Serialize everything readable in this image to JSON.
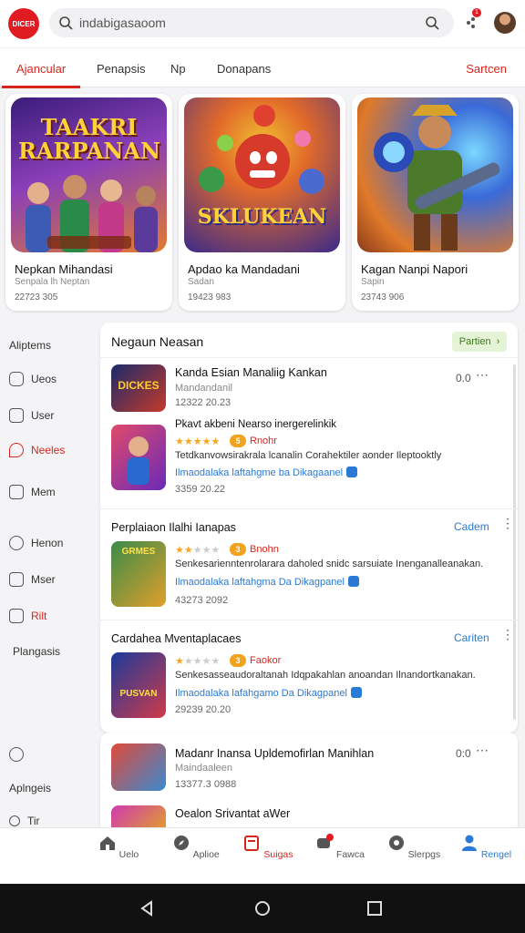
{
  "top": {
    "logo_text": "DICER",
    "search_text": "indabigasaoom",
    "notif_count": "1"
  },
  "tabs": {
    "items": [
      "Ajancular",
      "Penapsis",
      "Np",
      "Donapans"
    ],
    "right": "Sartcen"
  },
  "cards": [
    {
      "art_text": "TAAKRI RARPANAN",
      "title": "Nepkan Mihandasi",
      "sub": "Senpala lh Neptan",
      "num": "22723 305"
    },
    {
      "art_text": "SKLUKEAN",
      "title": "Apdao ka Mandadani",
      "sub": "Sadan",
      "num": "19423 983"
    },
    {
      "art_text": "",
      "title": "Kagan Nanpi Napori",
      "sub": "Sapin",
      "num": "23743 906"
    }
  ],
  "sidebar": [
    {
      "label": "Aliptems",
      "icon": "none"
    },
    {
      "label": "Ueos",
      "icon": "circle-icon"
    },
    {
      "label": "User",
      "icon": "square-icon"
    },
    {
      "label": "Neeles",
      "icon": "pin-icon"
    },
    {
      "label": "Mem",
      "icon": "image-icon"
    },
    {
      "label": "Henon",
      "icon": "circle-icon"
    },
    {
      "label": "Mser",
      "icon": "list-icon"
    },
    {
      "label": "Rilt",
      "icon": "doc-icon"
    },
    {
      "label": "Plangasis",
      "icon": "none"
    },
    {
      "label": "",
      "icon": "circle-icon"
    },
    {
      "label": "Aplngeis",
      "icon": "none"
    },
    {
      "label": "Tir",
      "icon": "search-icon"
    }
  ],
  "panel": {
    "title": "Negaun Neasan",
    "button": "Partien",
    "row1": {
      "title": "Kanda Esian Manaliig Kankan",
      "sub": "Mandandanil",
      "num": "12322 20.23",
      "score": "0.0",
      "thumb_text": "DICKES"
    },
    "row2": {
      "title": "Pkavt akbeni Nearso inergerelinkik",
      "rating_num": "5",
      "rating_tag": "Rnohr",
      "desc": "Tetdkanvowsirakrala lcanalin Corahektiler aonder Ileptooktly",
      "link": "Ilmaodalaka laftahgme ba Dikagaanel",
      "num": "3359 20.22"
    },
    "section2": {
      "title": "Perplaiaon Ilalhi Ianapas",
      "action": "Cadem",
      "rating_num": "3",
      "rating_tag": "Bnohn",
      "desc": "Senkesarienntenrolarara daholed snidc sarsuiate Inenganalleanakan.",
      "link": "Ilmaodalaka laftahgma Da Dikagpanel",
      "num": "43273 2092",
      "thumb_text": "GRMES"
    },
    "section3": {
      "title": "Cardahea Mventaplacaes",
      "action": "Cariten",
      "rating_num": "3",
      "rating_tag": "Faokor",
      "desc": "Senkesasseaudoraltanah Idqpakahlan anoandan Ilnandortkanakan.",
      "link": "Ilmaodalaka lafahgamo Da Dikagpanel",
      "num": "29239 20.20",
      "thumb_text": "PUSVAN"
    }
  },
  "panel2": {
    "title": "Madanr Inansa Upldemofirlan Manihlan",
    "sub": "Maindaaleen",
    "num": "13377.3 0988",
    "score": "0:0",
    "row2_title": "Oealon Srivantat aWer"
  },
  "bottom_nav": [
    {
      "label": "Uelo",
      "icon": "home-icon",
      "state": "normal"
    },
    {
      "label": "Aplioe",
      "icon": "compass-icon",
      "state": "normal"
    },
    {
      "label": "Suigas",
      "icon": "bag-icon",
      "state": "red"
    },
    {
      "label": "Fawca",
      "icon": "chat-icon",
      "state": "normal"
    },
    {
      "label": "Slerpgs",
      "icon": "settings-icon",
      "state": "normal"
    },
    {
      "label": "Rengel",
      "icon": "user-icon",
      "state": "active"
    }
  ],
  "colors": {
    "accent_red": "#d7261e",
    "accent_blue": "#2b79d6",
    "star": "#f5a623"
  }
}
